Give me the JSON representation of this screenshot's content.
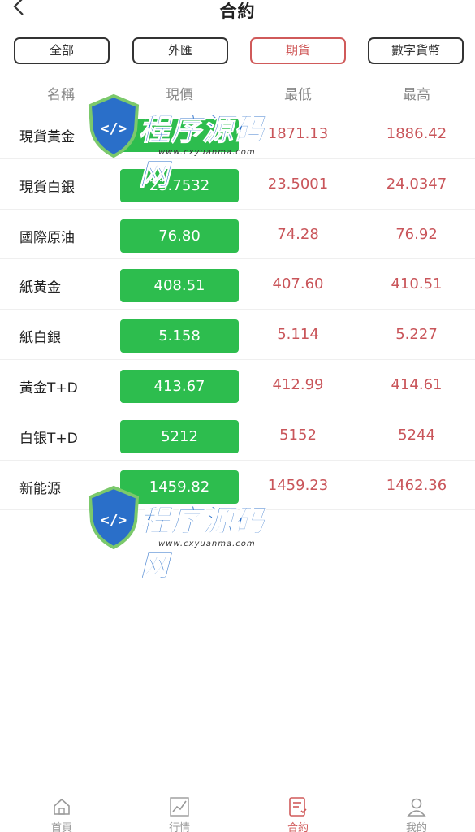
{
  "header": {
    "title": "合約"
  },
  "filters": [
    {
      "label": "全部",
      "active": false
    },
    {
      "label": "外匯",
      "active": false
    },
    {
      "label": "期貨",
      "active": true
    },
    {
      "label": "數字貨幣",
      "active": false
    }
  ],
  "columns": {
    "name": "名稱",
    "price": "現價",
    "low": "最低",
    "high": "最高"
  },
  "rows": [
    {
      "name": "現貨黃金",
      "price": "",
      "low": "1871.13",
      "high": "1886.42"
    },
    {
      "name": "現貨白銀",
      "price": "23.7532",
      "low": "23.5001",
      "high": "24.0347"
    },
    {
      "name": "國際原油",
      "price": "76.80",
      "low": "74.28",
      "high": "76.92"
    },
    {
      "name": "紙黃金",
      "price": "408.51",
      "low": "407.60",
      "high": "410.51"
    },
    {
      "name": "紙白銀",
      "price": "5.158",
      "low": "5.114",
      "high": "5.227"
    },
    {
      "name": "黃金T+D",
      "price": "413.67",
      "low": "412.99",
      "high": "414.61"
    },
    {
      "name": "白银T+D",
      "price": "5212",
      "low": "5152",
      "high": "5244"
    },
    {
      "name": "新能源",
      "price": "1459.82",
      "low": "1459.23",
      "high": "1462.36"
    }
  ],
  "watermark": {
    "title": "程序源码网",
    "url": "www.cxyuanma.com"
  },
  "tabbar": [
    {
      "label": "首頁",
      "icon": "home-icon",
      "active": false
    },
    {
      "label": "行情",
      "icon": "chart-icon",
      "active": false
    },
    {
      "label": "合約",
      "icon": "contract-icon",
      "active": true
    },
    {
      "label": "我的",
      "icon": "user-icon",
      "active": false
    }
  ],
  "colors": {
    "accent": "#d05a5a",
    "price_bg": "#2dbd4e",
    "range_text": "#c9555a"
  }
}
